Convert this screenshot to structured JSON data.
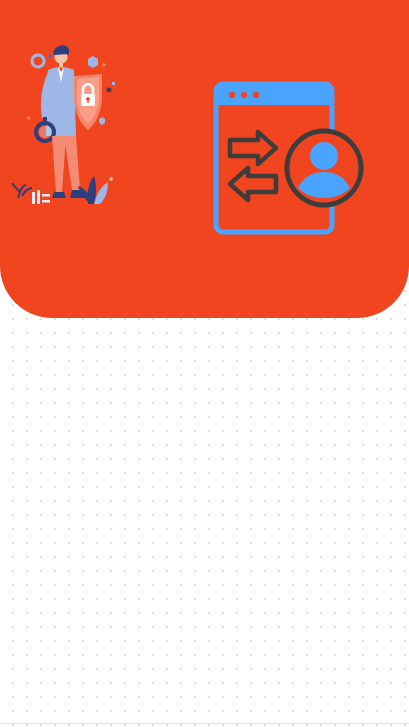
{
  "hero": {
    "background_color": "#f0451f",
    "illustration_icon": "person-with-shield-lock-illustration",
    "feature_icon": "browser-window-user-transfer-icon"
  },
  "colors": {
    "accent_blue": "#4aa3ff",
    "outline_dark": "#3d3d3d",
    "figure_blue": "#9db8e6",
    "figure_pants": "#f58b73"
  }
}
